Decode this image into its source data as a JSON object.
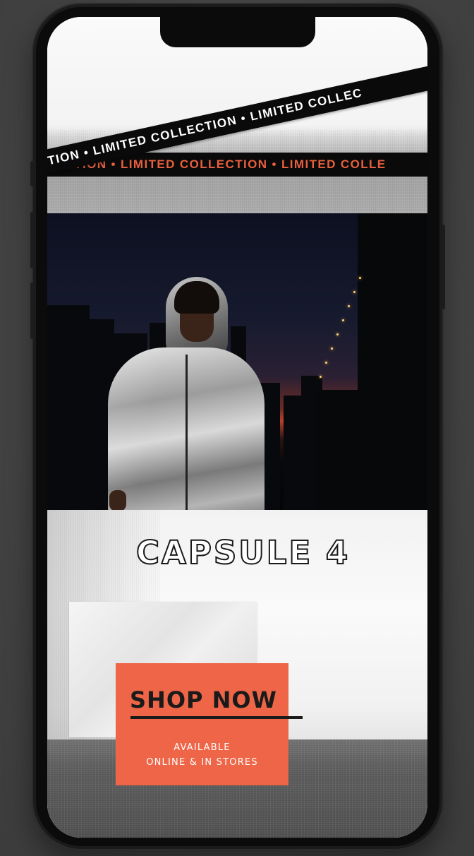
{
  "banner": {
    "tape_text_orange": "LECTION • LIMITED COLLECTION • LIMITED COLLE",
    "tape_text_white": "LECTION • LIMITED COLLECTION • LIMITED COLLEC"
  },
  "hero": {
    "title": "CAPSULE 4"
  },
  "cta": {
    "label": "SHOP NOW",
    "availability_line1": "AVAILABLE",
    "availability_line2": "ONLINE & IN STORES"
  },
  "colors": {
    "accent": "#ee6547",
    "tape": "#0a0a0a",
    "tape_text": "#e8603d"
  }
}
